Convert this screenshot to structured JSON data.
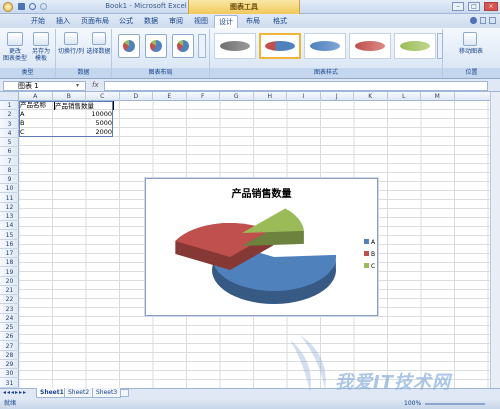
{
  "window": {
    "title": "Book1 - Microsoft Excel",
    "contextual": "图表工具"
  },
  "tabs": [
    "开始",
    "插入",
    "页面布局",
    "公式",
    "数据",
    "审阅",
    "视图",
    "设计",
    "布局",
    "格式"
  ],
  "ribbon": {
    "groups": {
      "type": "类型",
      "data": "数据",
      "layout": "图表布局",
      "styles": "图表样式",
      "location": "位置"
    },
    "buttons": {
      "change_type": "更改\n图表类型",
      "save_template": "另存为\n模板",
      "switch_rowcol": "切换行/列",
      "select_data": "选择数据",
      "move_chart": "移动图表"
    }
  },
  "formula_bar": {
    "name_box": "图表 1",
    "fx": "fx",
    "formula": ""
  },
  "columns": [
    "A",
    "B",
    "C",
    "D",
    "E",
    "F",
    "G",
    "H",
    "I",
    "J",
    "K",
    "L",
    "M"
  ],
  "rows": [
    "1",
    "2",
    "3",
    "4",
    "5",
    "6",
    "7",
    "8",
    "9",
    "10",
    "11",
    "12",
    "13",
    "14",
    "15",
    "16",
    "17",
    "18",
    "19",
    "20",
    "21",
    "22",
    "23",
    "24",
    "25",
    "26",
    "27",
    "28",
    "29",
    "30",
    "31"
  ],
  "cells": {
    "A1": "产品名称",
    "B1": "产品销售数量",
    "A2": "A",
    "B2": "10000",
    "A3": "B",
    "B3": "5000",
    "A4": "C",
    "B4": "2000"
  },
  "chart_data": {
    "type": "pie",
    "title": "产品销售数量",
    "categories": [
      "A",
      "B",
      "C"
    ],
    "values": [
      10000,
      5000,
      2000
    ],
    "legend": "right",
    "colors": {
      "A": "#4f81bd",
      "B": "#c0504d",
      "C": "#9bbb59"
    }
  },
  "sheets": [
    "Sheet1",
    "Sheet2",
    "Sheet3"
  ],
  "status": {
    "ready": "就绪",
    "zoom": "100%"
  },
  "watermark": "我爱IT技术网"
}
